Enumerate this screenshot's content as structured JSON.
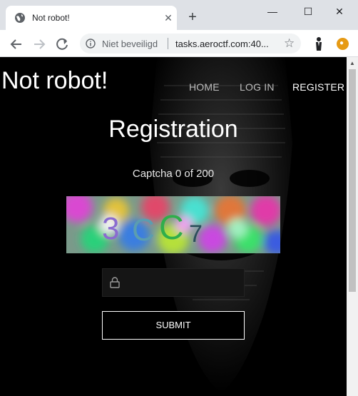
{
  "browser": {
    "tab_title": "Not robot!",
    "new_tab": "+",
    "security_label": "Niet beveiligd",
    "url": "tasks.aeroctf.com:40...",
    "icons": [
      "globe-icon",
      "close-icon",
      "back-icon",
      "forward-icon",
      "reload-icon",
      "info-icon",
      "star-icon",
      "minimize-icon",
      "maximize-icon",
      "window-close-icon"
    ]
  },
  "site": {
    "brand": "Not robot!",
    "nav": [
      {
        "label": "HOME"
      },
      {
        "label": "LOG IN"
      },
      {
        "label": "REGISTER"
      }
    ]
  },
  "registration": {
    "title": "Registration",
    "counter": "Captcha 0 of 200",
    "captcha_text": "3CC7",
    "input_value": "",
    "submit_label": "SUBMIT"
  },
  "colors": {
    "page_bg": "#000000",
    "text": "#ffffff",
    "captcha_chars": [
      "#8a6bd0",
      "#5b9db0",
      "#2fae4b",
      "#2b4e5a"
    ]
  }
}
